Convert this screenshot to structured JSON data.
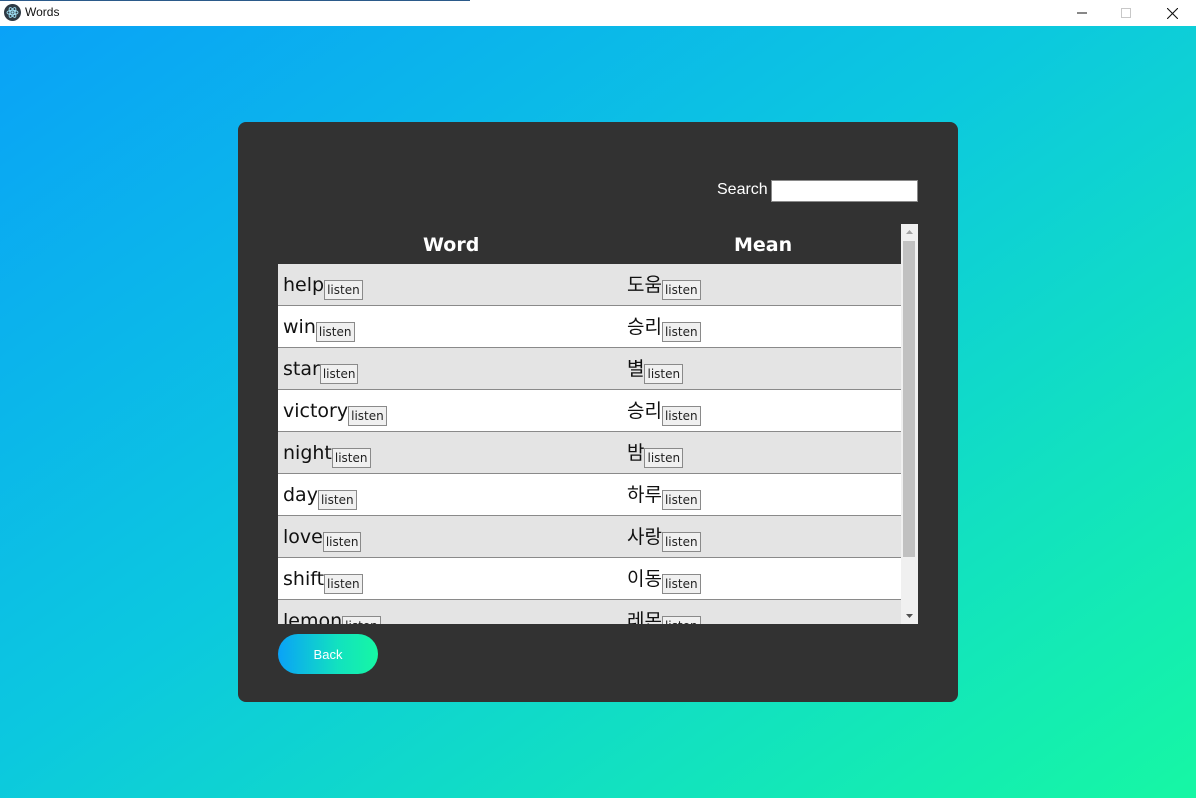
{
  "window": {
    "title": "Words"
  },
  "search": {
    "label": "Search",
    "value": ""
  },
  "table": {
    "headers": {
      "word": "Word",
      "mean": "Mean"
    },
    "listen_label": "listen",
    "rows": [
      {
        "word": "help",
        "mean": "도움"
      },
      {
        "word": "win",
        "mean": "승리"
      },
      {
        "word": "star",
        "mean": "별"
      },
      {
        "word": "victory",
        "mean": "승리"
      },
      {
        "word": "night",
        "mean": "밤"
      },
      {
        "word": "day",
        "mean": "하루"
      },
      {
        "word": "love",
        "mean": "사랑"
      },
      {
        "word": "shift",
        "mean": "이동"
      },
      {
        "word": "lemon",
        "mean": "레몬"
      }
    ]
  },
  "back": {
    "label": "Back"
  },
  "colors": {
    "card": "#323232",
    "gradient_start": "#0aa2f7",
    "gradient_end": "#16f7a4",
    "row_alt": "#e4e4e4"
  },
  "icons": {
    "app": "electron-atom-icon",
    "minimize": "minimize-icon",
    "maximize": "maximize-icon",
    "close": "close-icon"
  }
}
